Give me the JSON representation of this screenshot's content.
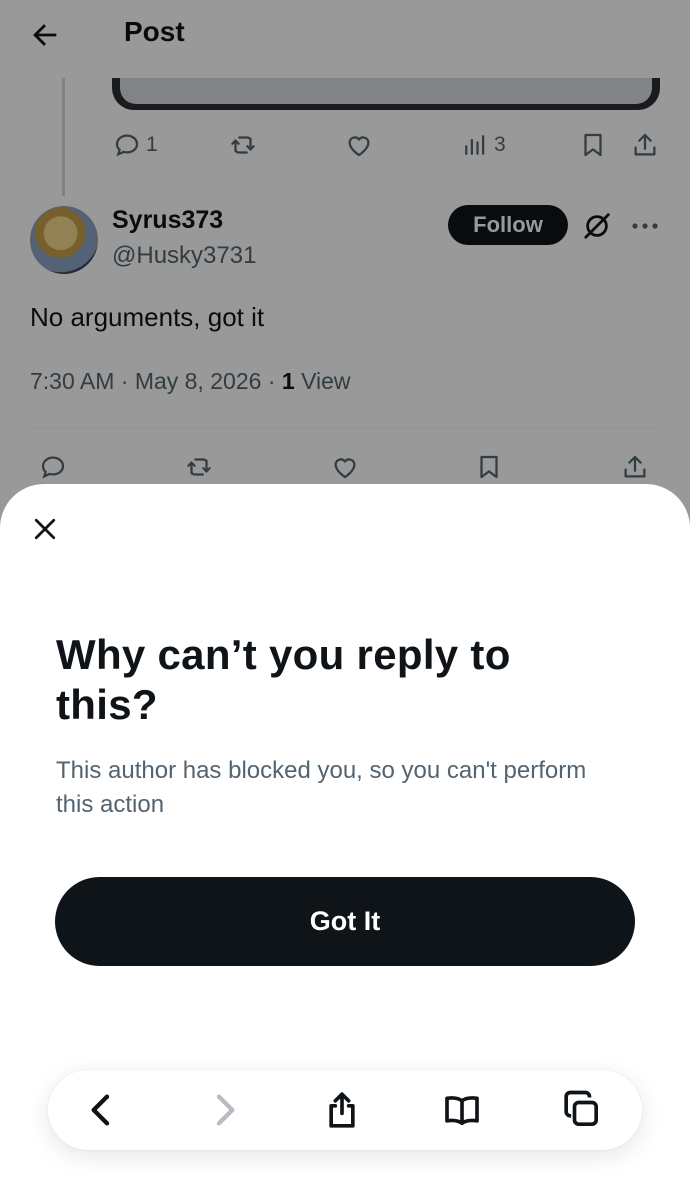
{
  "header": {
    "title": "Post"
  },
  "parent_post": {
    "actions": {
      "replies": "1",
      "views": "3"
    }
  },
  "post": {
    "author_name": "Syrus373",
    "author_handle": "@Husky3731",
    "follow_label": "Follow",
    "text": "No arguments, got it",
    "time": "7:30 AM",
    "date": "May 8, 2026",
    "views_count": "1",
    "views_label": "View"
  },
  "sheet": {
    "title": "Why can’t you reply to this?",
    "body": "This author has blocked you, so you can't perform this action",
    "button_label": "Got It"
  },
  "browser_toolbar": {
    "icons": [
      "back-icon",
      "forward-icon",
      "share-icon",
      "bookmarks-icon",
      "tabs-icon"
    ]
  },
  "colors": {
    "primary_text": "#0f1419",
    "secondary_text": "#536471",
    "button_bg": "#0f1419"
  }
}
